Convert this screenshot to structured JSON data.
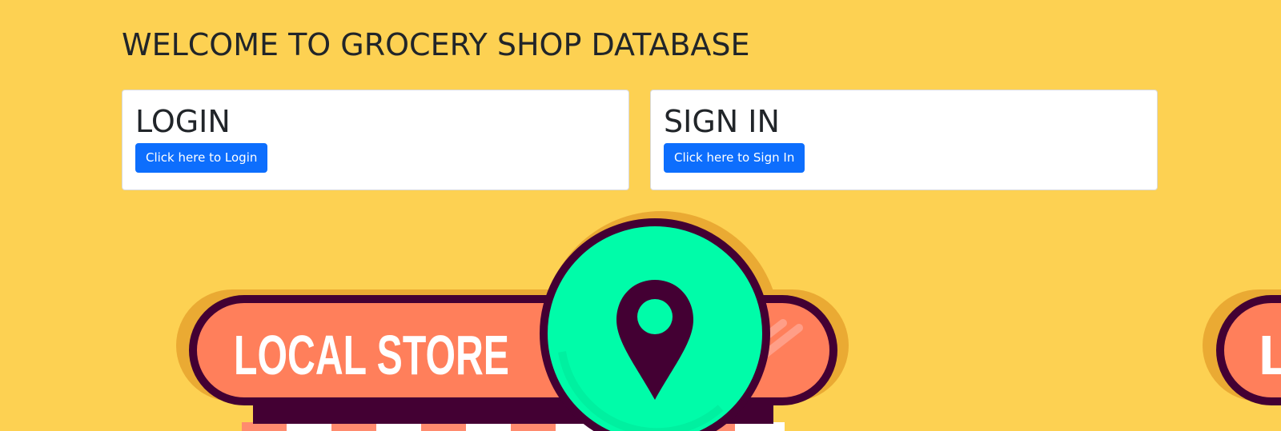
{
  "page": {
    "title": "WELCOME TO GROCERY SHOP DATABASE"
  },
  "cards": {
    "login": {
      "title": "LOGIN",
      "button_label": "Click here to Login"
    },
    "signin": {
      "title": "SIGN IN",
      "button_label": "Click here to Sign In"
    }
  },
  "background": {
    "sign_text": "LOCAL STORE",
    "sign_text_partial": "L",
    "icon": "location-pin-icon"
  },
  "colors": {
    "background": "#FDD152",
    "sign_orange": "#FF7F5B",
    "sign_outline": "#430033",
    "pin_circle": "#00FCA9",
    "halo": "#EAAA33",
    "button_primary": "#0D6EFD"
  }
}
